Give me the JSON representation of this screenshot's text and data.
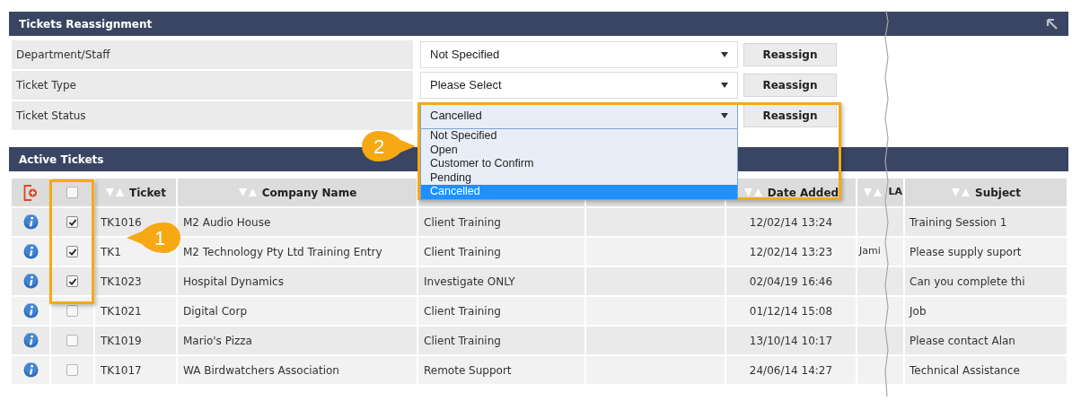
{
  "reassign_panel": {
    "title": "Tickets Reassignment",
    "rows": [
      {
        "label": "Department/Staff",
        "value": "Not Specified",
        "button": "Reassign",
        "open": false
      },
      {
        "label": "Ticket Type",
        "value": "Please Select",
        "button": "Reassign",
        "open": false
      },
      {
        "label": "Ticket Status",
        "value": "Cancelled",
        "button": "Reassign",
        "open": true,
        "options": [
          {
            "label": "Not Specified",
            "selected": false
          },
          {
            "label": "Open",
            "selected": false
          },
          {
            "label": "Customer to Confirm",
            "selected": false
          },
          {
            "label": "Pending",
            "selected": false
          },
          {
            "label": "Cancelled",
            "selected": true
          }
        ]
      }
    ]
  },
  "tickets_panel": {
    "title": "Active Tickets",
    "select_all_checked": false,
    "columns": [
      {
        "label": "Ticket"
      },
      {
        "label": "Company Name"
      },
      {},
      {},
      {
        "label": "Date Added"
      },
      {
        "label": "LA"
      },
      {
        "label": "Subject"
      }
    ],
    "rows": [
      {
        "checked": true,
        "ticket": "TK1016",
        "company": "M2 Audio House",
        "column_4": "Client Training",
        "date": "12/02/14 13:24",
        "sla": "",
        "subject": "Training Session 1"
      },
      {
        "checked": true,
        "ticket": "TK1",
        "company": "M2 Technology Pty Ltd Training Entry",
        "column_4": "Client Training",
        "date": "12/02/14 13:23",
        "sla": "Jami",
        "subject": "Please supply suport"
      },
      {
        "checked": true,
        "ticket": "TK1023",
        "company": "Hospital Dynamics",
        "column_4": "Investigate ONLY",
        "date": "02/04/19 16:46",
        "sla": "",
        "subject": "Can you complete thi"
      },
      {
        "checked": false,
        "ticket": "TK1021",
        "company": "Digital Corp",
        "column_4": "Client Training",
        "date": "01/12/14 15:08",
        "sla": "",
        "subject": "Job"
      },
      {
        "checked": false,
        "ticket": "TK1019",
        "company": "Mario's Pizza",
        "column_4": "Client Training",
        "date": "13/10/14 10:17",
        "sla": "",
        "subject": "Please contact Alan"
      },
      {
        "checked": false,
        "ticket": "TK1017",
        "company": "WA Birdwatchers Association",
        "column_4": "Remote Support",
        "date": "24/06/14 14:27",
        "sla": "",
        "subject": "Technical Assistance"
      }
    ]
  },
  "callouts": [
    {
      "label": "2"
    },
    {
      "label": "1"
    }
  ]
}
